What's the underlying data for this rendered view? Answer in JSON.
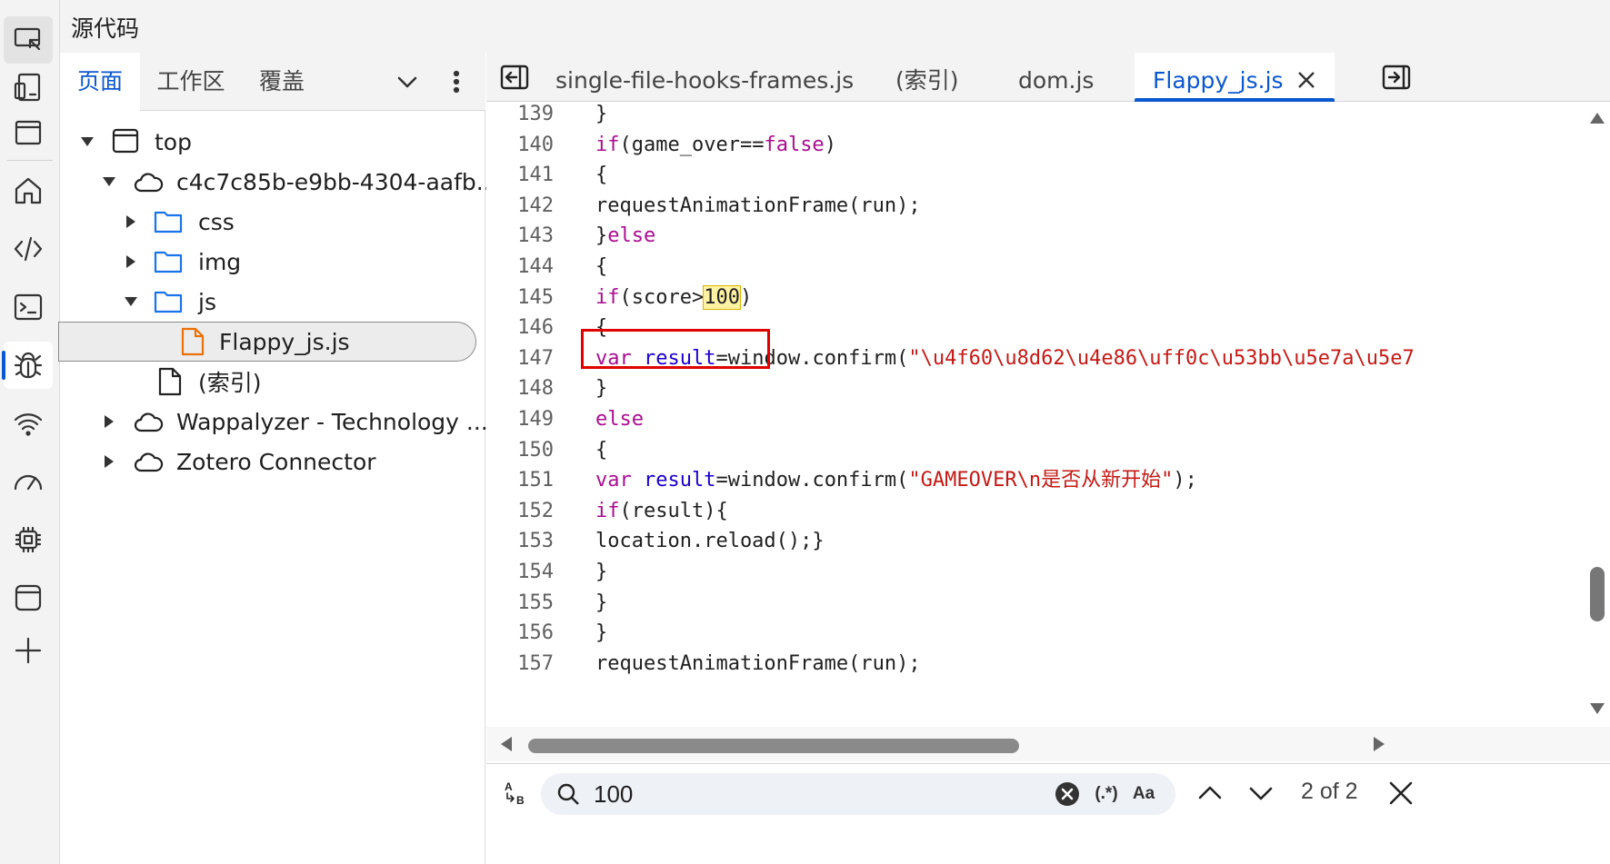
{
  "panel_title": "源代码",
  "navigator": {
    "tabs": [
      "页面",
      "工作区",
      "覆盖"
    ],
    "active_tab": 0,
    "tree": [
      {
        "label": "top",
        "kind": "frame",
        "depth": 0,
        "expanded": true
      },
      {
        "label": "c4c7c85b-e9bb-4304-aafb...",
        "kind": "cloud",
        "depth": 1,
        "expanded": true
      },
      {
        "label": "css",
        "kind": "folder",
        "depth": 2,
        "expanded": false
      },
      {
        "label": "img",
        "kind": "folder",
        "depth": 2,
        "expanded": false
      },
      {
        "label": "js",
        "kind": "folder",
        "depth": 2,
        "expanded": true
      },
      {
        "label": "Flappy_js.js",
        "kind": "file-js",
        "depth": 3,
        "selected": true
      },
      {
        "label": "(索引)",
        "kind": "file",
        "depth": 2
      },
      {
        "label": "Wappalyzer - Technology ...",
        "kind": "cloud",
        "depth": 1,
        "expanded": false
      },
      {
        "label": "Zotero Connector",
        "kind": "cloud",
        "depth": 1,
        "expanded": false
      }
    ]
  },
  "editor": {
    "tabs": [
      {
        "label": "single-file-hooks-frames.js",
        "active": false
      },
      {
        "label": "(索引)",
        "active": false
      },
      {
        "label": "dom.js",
        "active": false
      },
      {
        "label": "Flappy_js.js",
        "active": true
      }
    ],
    "lines": [
      {
        "num": "139",
        "tokens": [
          {
            "t": "}",
            "c": ""
          }
        ]
      },
      {
        "num": "140",
        "tokens": [
          {
            "t": "if",
            "c": "kw"
          },
          {
            "t": "(game_over==",
            "c": ""
          },
          {
            "t": "false",
            "c": "kw"
          },
          {
            "t": ")",
            "c": ""
          }
        ]
      },
      {
        "num": "141",
        "tokens": [
          {
            "t": "{",
            "c": ""
          }
        ]
      },
      {
        "num": "142",
        "tokens": [
          {
            "t": "requestAnimationFrame(run);",
            "c": ""
          }
        ]
      },
      {
        "num": "143",
        "tokens": [
          {
            "t": "}",
            "c": ""
          },
          {
            "t": "else",
            "c": "kw"
          }
        ]
      },
      {
        "num": "144",
        "tokens": [
          {
            "t": "{",
            "c": ""
          }
        ]
      },
      {
        "num": "145",
        "tokens": [
          {
            "t": "if",
            "c": "kw"
          },
          {
            "t": "(score>",
            "c": ""
          },
          {
            "t": "100",
            "c": "hl"
          },
          {
            "t": ")",
            "c": ""
          }
        ]
      },
      {
        "num": "146",
        "tokens": [
          {
            "t": "{",
            "c": ""
          }
        ]
      },
      {
        "num": "147",
        "tokens": [
          {
            "t": "var",
            "c": "kw"
          },
          {
            "t": " ",
            "c": ""
          },
          {
            "t": "result",
            "c": "var"
          },
          {
            "t": "=window.confirm(",
            "c": ""
          },
          {
            "t": "\"\\u4f60\\u8d62\\u4e86\\uff0c\\u53bb\\u5e7a\\u5e7",
            "c": "str"
          }
        ]
      },
      {
        "num": "148",
        "tokens": [
          {
            "t": "}",
            "c": ""
          }
        ]
      },
      {
        "num": "149",
        "tokens": [
          {
            "t": "else",
            "c": "kw"
          }
        ]
      },
      {
        "num": "150",
        "tokens": [
          {
            "t": "{",
            "c": ""
          }
        ]
      },
      {
        "num": "151",
        "tokens": [
          {
            "t": "var",
            "c": "kw"
          },
          {
            "t": " ",
            "c": ""
          },
          {
            "t": "result",
            "c": "var"
          },
          {
            "t": "=window.confirm(",
            "c": ""
          },
          {
            "t": "\"GAMEOVER\\n是否从新开始\"",
            "c": "str"
          },
          {
            "t": ");",
            "c": ""
          }
        ]
      },
      {
        "num": "152",
        "tokens": [
          {
            "t": "if",
            "c": "kw"
          },
          {
            "t": "(result){",
            "c": ""
          }
        ]
      },
      {
        "num": "153",
        "tokens": [
          {
            "t": "location.reload();}",
            "c": ""
          }
        ]
      },
      {
        "num": "154",
        "tokens": [
          {
            "t": "}",
            "c": ""
          }
        ]
      },
      {
        "num": "155",
        "tokens": [
          {
            "t": "}",
            "c": ""
          }
        ]
      },
      {
        "num": "156",
        "tokens": [
          {
            "t": "}",
            "c": ""
          }
        ]
      },
      {
        "num": "157",
        "tokens": [
          {
            "t": "requestAnimationFrame(run);",
            "c": ""
          }
        ]
      }
    ]
  },
  "search": {
    "value": "100",
    "regex_label": "(.*)",
    "case_label": "Aa",
    "match_count": "2 of 2",
    "replace_label": "AB"
  },
  "activity_icons": [
    "inspect-icon",
    "device-icon",
    "window-icon",
    "home-icon",
    "code-icon",
    "console-icon",
    "bug-icon",
    "wifi-icon",
    "gauge-icon",
    "chip-icon",
    "app-icon",
    "plus-icon"
  ],
  "colors": {
    "accent": "#0b57d0",
    "keyword": "#aa0d91",
    "string": "#c41a16",
    "highlight_box": "#e00000"
  }
}
